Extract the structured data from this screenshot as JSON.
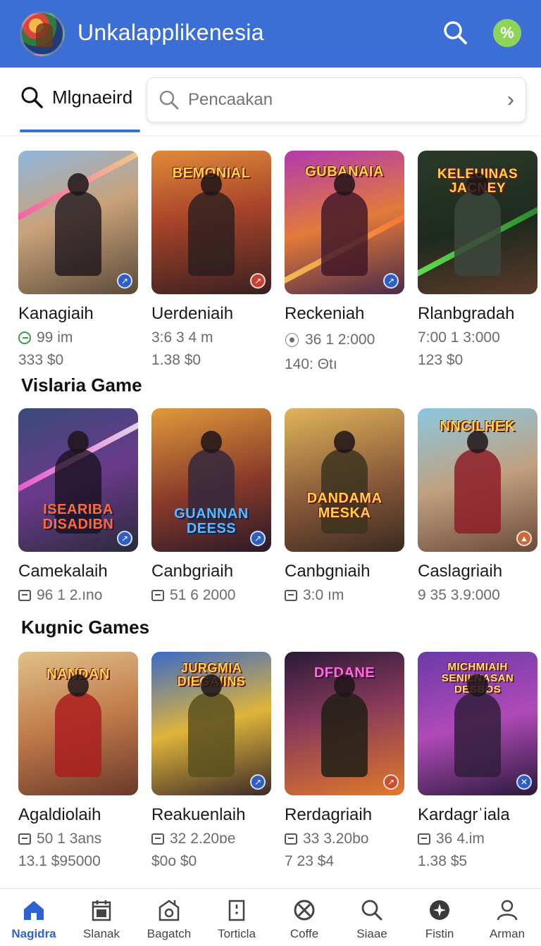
{
  "header": {
    "title": "Unkalapplikenesia",
    "badge_symbol": "%",
    "bar_color": "#3b6fd6"
  },
  "search": {
    "tab_label": "Mlgnaeird",
    "placeholder": "Pencaakan"
  },
  "sections": [
    {
      "title": "",
      "games": [
        {
          "name": "Kanagiaih",
          "meta1": "99  im",
          "meta2": "333 $0",
          "art": "ART1",
          "icon": "green-circle"
        },
        {
          "name": "Uerdeniaih",
          "meta1": "3:6 3 4 m",
          "meta2": "1.38 $0",
          "art": "BEMONIAL",
          "icon": "none"
        },
        {
          "name": "Reckeniah",
          "meta1": "36 1 2:000",
          "meta2": "140: Θtı",
          "art": "GUBANAIA",
          "icon": "pin"
        },
        {
          "name": "Rlanbgradah",
          "meta1": "7:00  1 3:000",
          "meta2": "123 $0",
          "art": "KELEUINAS JACNEY",
          "icon": "none"
        }
      ]
    },
    {
      "title": "Vislaria Game",
      "games": [
        {
          "name": "Camekalaih",
          "meta1": "96 1 2.ıno",
          "art": "ISEARIBA DISADIBN",
          "icon": "box"
        },
        {
          "name": "Canbgriaih",
          "meta1": "51 6 2000",
          "art": "GUANNAN DEESS",
          "icon": "box"
        },
        {
          "name": "Canbgniaih",
          "meta1": "3:0 ım",
          "art": "DANDAMA MESKA",
          "icon": "box"
        },
        {
          "name": "Caslagriaih",
          "meta1": "9 35 3.9:000",
          "art": "NNCILHEK",
          "icon": "none"
        }
      ]
    },
    {
      "title": "Kugnic Games",
      "games": [
        {
          "name": "Agaldiolaih",
          "meta1": "50 1 3ans",
          "meta2": "13.1 $95000",
          "art": "NANDAN",
          "icon": "box"
        },
        {
          "name": "Reakuenlaih",
          "meta1": "32 2.20ɒe",
          "meta2": "$0o $0",
          "art": "JURGMIA DIEGAIINS",
          "icon": "box"
        },
        {
          "name": "Rerdagriaih",
          "meta1": "33 3.20bo",
          "meta2": "7 23 $4",
          "art": "DFDANE",
          "icon": "box"
        },
        {
          "name": "Kardagrˈiala",
          "meta1": "36 4.im",
          "meta2": "1.38 $5",
          "art": "MICHMIAIH SENILNASAN DESBOS",
          "icon": "box"
        }
      ]
    }
  ],
  "bottom_nav": [
    {
      "label": "Nagidra",
      "icon": "home-icon",
      "active": true
    },
    {
      "label": "Slanak",
      "icon": "calendar-icon",
      "active": false
    },
    {
      "label": "Bagatch",
      "icon": "store-icon",
      "active": false
    },
    {
      "label": "Torticla",
      "icon": "document-icon",
      "active": false
    },
    {
      "label": "Coffe",
      "icon": "blocked-circle-icon",
      "active": false
    },
    {
      "label": "Siaae",
      "icon": "search-icon",
      "active": false
    },
    {
      "label": "Fistin",
      "icon": "gamepad-icon",
      "active": false
    },
    {
      "label": "Arman",
      "icon": "user-icon",
      "active": false
    }
  ],
  "colors": {
    "accent": "#3b6fd6",
    "active_nav": "#2d63d0",
    "badge": "#8ed35a"
  }
}
